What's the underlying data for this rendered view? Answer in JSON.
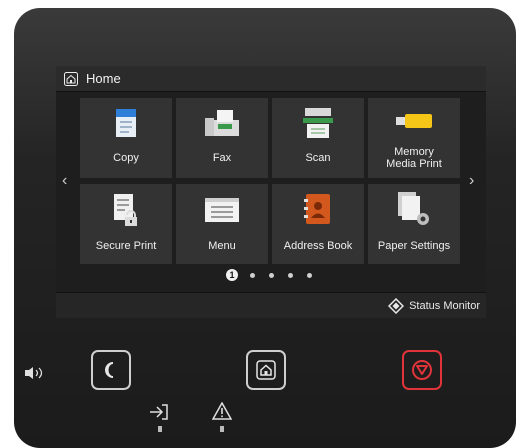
{
  "header": {
    "title": "Home",
    "home_icon": "home-icon"
  },
  "tiles": [
    {
      "label": "Copy",
      "icon": "copy-icon"
    },
    {
      "label": "Fax",
      "icon": "fax-icon"
    },
    {
      "label": "Scan",
      "icon": "scan-icon"
    },
    {
      "label": "Memory\nMedia Print",
      "icon": "memory-media-icon"
    },
    {
      "label": "Secure Print",
      "icon": "secure-print-icon"
    },
    {
      "label": "Menu",
      "icon": "menu-icon"
    },
    {
      "label": "Address Book",
      "icon": "address-book-icon"
    },
    {
      "label": "Paper Settings",
      "icon": "paper-settings-icon"
    }
  ],
  "pagination": {
    "current": "1",
    "total_pages": 5
  },
  "status_monitor": {
    "label": "Status Monitor",
    "icon": "status-monitor-icon"
  },
  "hardware": {
    "volume_icon": "speaker-icon",
    "energy_saver_icon": "moon-icon",
    "home_button_icon": "home-icon",
    "stop_icon": "stop-icon",
    "data_led_icon": "data-arrow-icon",
    "error_led_icon": "warning-icon"
  },
  "colors": {
    "stop": "#e0343a",
    "memory_media": "#f5c518",
    "fax_green": "#3a9a4c",
    "address_book": "#d2581e"
  }
}
